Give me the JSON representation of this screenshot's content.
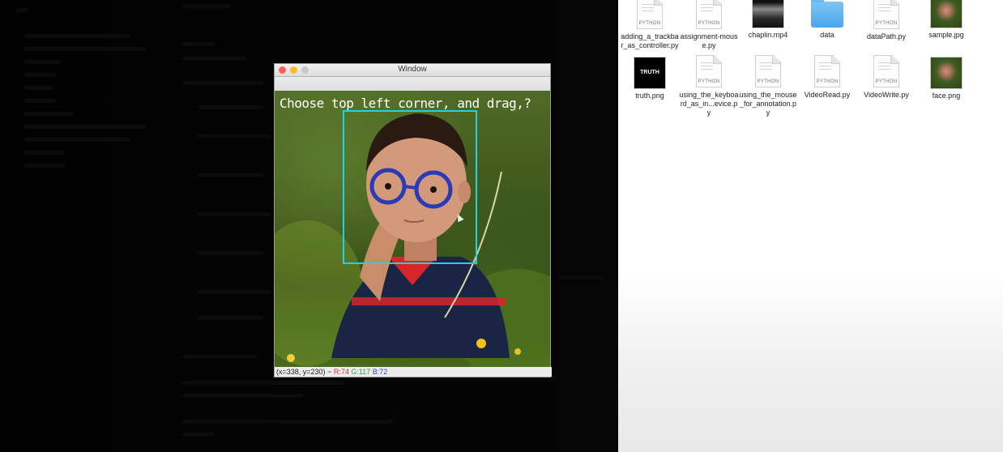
{
  "window": {
    "title": "Window",
    "prompt_text": "Choose top left corner, and drag,?",
    "status": {
      "coords": "(x=338, y=230) ~",
      "r": "R:74",
      "g": "G:117",
      "b": "B:72"
    }
  },
  "finder": {
    "files": [
      {
        "name": "adding_a_trackbar_as_controller.py",
        "kind": "python",
        "tag": "PYTHON"
      },
      {
        "name": "assignment-mouse.py",
        "kind": "python",
        "tag": "PYTHON"
      },
      {
        "name": "chaplin.mp4",
        "kind": "video"
      },
      {
        "name": "data",
        "kind": "folder"
      },
      {
        "name": "dataPath.py",
        "kind": "python",
        "tag": "PYTHON"
      },
      {
        "name": "sample.jpg",
        "kind": "image"
      },
      {
        "name": "truth.png",
        "kind": "truth",
        "tag": "TRUTH"
      },
      {
        "name": "using_the_keyboard_as_in...evice.py",
        "kind": "python",
        "tag": "PYTHON"
      },
      {
        "name": "using_the_mouse_for_annotation.py",
        "kind": "python",
        "tag": "PYTHON"
      },
      {
        "name": "VideoRead.py",
        "kind": "python",
        "tag": "PYTHON"
      },
      {
        "name": "VideoWrite.py",
        "kind": "python",
        "tag": "PYTHON"
      },
      {
        "name": "face.png",
        "kind": "image"
      }
    ]
  },
  "colors": {
    "roi_box": "#1fd3e6",
    "status_r": "#e0342a",
    "status_g": "#3aa63a",
    "status_b": "#2e45d6",
    "close": "#fc5f57",
    "minimize": "#fdbc2e",
    "zoom": "#c8c8c8"
  }
}
